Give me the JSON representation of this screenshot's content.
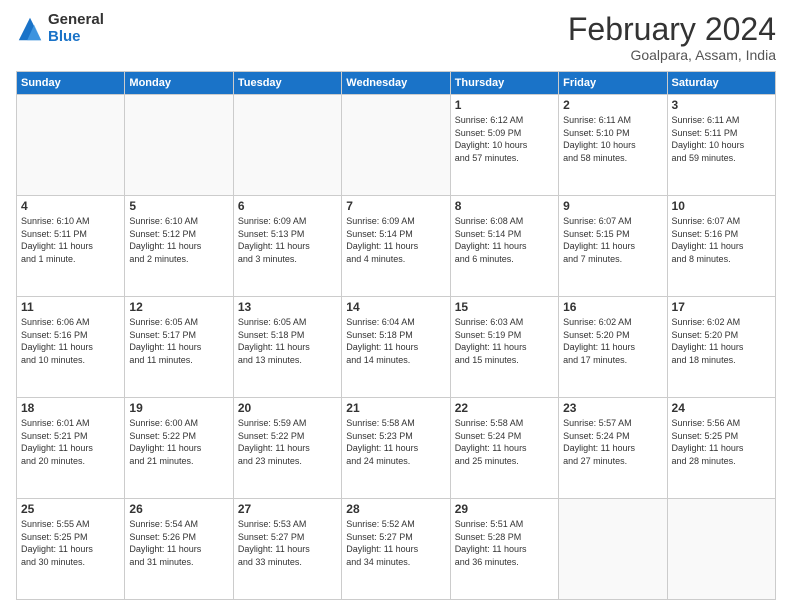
{
  "logo": {
    "line1": "General",
    "line2": "Blue"
  },
  "title": "February 2024",
  "subtitle": "Goalpara, Assam, India",
  "days_of_week": [
    "Sunday",
    "Monday",
    "Tuesday",
    "Wednesday",
    "Thursday",
    "Friday",
    "Saturday"
  ],
  "weeks": [
    [
      {
        "day": "",
        "info": ""
      },
      {
        "day": "",
        "info": ""
      },
      {
        "day": "",
        "info": ""
      },
      {
        "day": "",
        "info": ""
      },
      {
        "day": "1",
        "info": "Sunrise: 6:12 AM\nSunset: 5:09 PM\nDaylight: 10 hours\nand 57 minutes."
      },
      {
        "day": "2",
        "info": "Sunrise: 6:11 AM\nSunset: 5:10 PM\nDaylight: 10 hours\nand 58 minutes."
      },
      {
        "day": "3",
        "info": "Sunrise: 6:11 AM\nSunset: 5:11 PM\nDaylight: 10 hours\nand 59 minutes."
      }
    ],
    [
      {
        "day": "4",
        "info": "Sunrise: 6:10 AM\nSunset: 5:11 PM\nDaylight: 11 hours\nand 1 minute."
      },
      {
        "day": "5",
        "info": "Sunrise: 6:10 AM\nSunset: 5:12 PM\nDaylight: 11 hours\nand 2 minutes."
      },
      {
        "day": "6",
        "info": "Sunrise: 6:09 AM\nSunset: 5:13 PM\nDaylight: 11 hours\nand 3 minutes."
      },
      {
        "day": "7",
        "info": "Sunrise: 6:09 AM\nSunset: 5:14 PM\nDaylight: 11 hours\nand 4 minutes."
      },
      {
        "day": "8",
        "info": "Sunrise: 6:08 AM\nSunset: 5:14 PM\nDaylight: 11 hours\nand 6 minutes."
      },
      {
        "day": "9",
        "info": "Sunrise: 6:07 AM\nSunset: 5:15 PM\nDaylight: 11 hours\nand 7 minutes."
      },
      {
        "day": "10",
        "info": "Sunrise: 6:07 AM\nSunset: 5:16 PM\nDaylight: 11 hours\nand 8 minutes."
      }
    ],
    [
      {
        "day": "11",
        "info": "Sunrise: 6:06 AM\nSunset: 5:16 PM\nDaylight: 11 hours\nand 10 minutes."
      },
      {
        "day": "12",
        "info": "Sunrise: 6:05 AM\nSunset: 5:17 PM\nDaylight: 11 hours\nand 11 minutes."
      },
      {
        "day": "13",
        "info": "Sunrise: 6:05 AM\nSunset: 5:18 PM\nDaylight: 11 hours\nand 13 minutes."
      },
      {
        "day": "14",
        "info": "Sunrise: 6:04 AM\nSunset: 5:18 PM\nDaylight: 11 hours\nand 14 minutes."
      },
      {
        "day": "15",
        "info": "Sunrise: 6:03 AM\nSunset: 5:19 PM\nDaylight: 11 hours\nand 15 minutes."
      },
      {
        "day": "16",
        "info": "Sunrise: 6:02 AM\nSunset: 5:20 PM\nDaylight: 11 hours\nand 17 minutes."
      },
      {
        "day": "17",
        "info": "Sunrise: 6:02 AM\nSunset: 5:20 PM\nDaylight: 11 hours\nand 18 minutes."
      }
    ],
    [
      {
        "day": "18",
        "info": "Sunrise: 6:01 AM\nSunset: 5:21 PM\nDaylight: 11 hours\nand 20 minutes."
      },
      {
        "day": "19",
        "info": "Sunrise: 6:00 AM\nSunset: 5:22 PM\nDaylight: 11 hours\nand 21 minutes."
      },
      {
        "day": "20",
        "info": "Sunrise: 5:59 AM\nSunset: 5:22 PM\nDaylight: 11 hours\nand 23 minutes."
      },
      {
        "day": "21",
        "info": "Sunrise: 5:58 AM\nSunset: 5:23 PM\nDaylight: 11 hours\nand 24 minutes."
      },
      {
        "day": "22",
        "info": "Sunrise: 5:58 AM\nSunset: 5:24 PM\nDaylight: 11 hours\nand 25 minutes."
      },
      {
        "day": "23",
        "info": "Sunrise: 5:57 AM\nSunset: 5:24 PM\nDaylight: 11 hours\nand 27 minutes."
      },
      {
        "day": "24",
        "info": "Sunrise: 5:56 AM\nSunset: 5:25 PM\nDaylight: 11 hours\nand 28 minutes."
      }
    ],
    [
      {
        "day": "25",
        "info": "Sunrise: 5:55 AM\nSunset: 5:25 PM\nDaylight: 11 hours\nand 30 minutes."
      },
      {
        "day": "26",
        "info": "Sunrise: 5:54 AM\nSunset: 5:26 PM\nDaylight: 11 hours\nand 31 minutes."
      },
      {
        "day": "27",
        "info": "Sunrise: 5:53 AM\nSunset: 5:27 PM\nDaylight: 11 hours\nand 33 minutes."
      },
      {
        "day": "28",
        "info": "Sunrise: 5:52 AM\nSunset: 5:27 PM\nDaylight: 11 hours\nand 34 minutes."
      },
      {
        "day": "29",
        "info": "Sunrise: 5:51 AM\nSunset: 5:28 PM\nDaylight: 11 hours\nand 36 minutes."
      },
      {
        "day": "",
        "info": ""
      },
      {
        "day": "",
        "info": ""
      }
    ]
  ]
}
